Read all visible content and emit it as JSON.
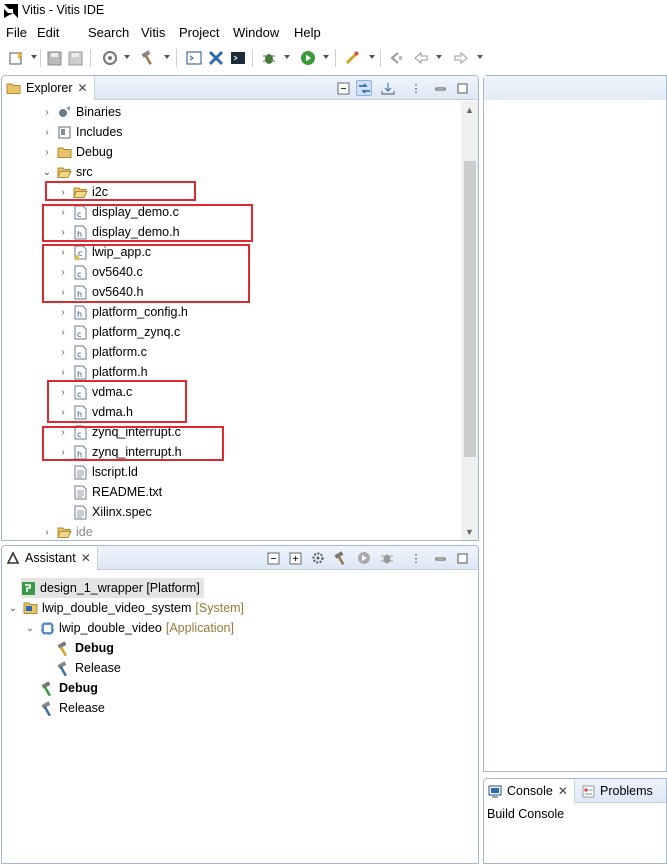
{
  "window": {
    "title": "Vitis - Vitis IDE"
  },
  "menu": [
    "File",
    "Edit",
    "Search",
    "Vitis",
    "Project",
    "Window",
    "Help"
  ],
  "explorer": {
    "tab_label": "Explorer",
    "items": [
      {
        "label": "Binaries",
        "icon": "binaries-icon"
      },
      {
        "label": "Includes",
        "icon": "includes-icon"
      },
      {
        "label": "Debug",
        "icon": "folder-icon"
      },
      {
        "label": "src",
        "icon": "folder-open-icon"
      },
      {
        "label": "i2c",
        "icon": "folder-icon"
      },
      {
        "label": "display_demo.c",
        "icon": "c-file-icon"
      },
      {
        "label": "display_demo.h",
        "icon": "h-file-icon"
      },
      {
        "label": "lwip_app.c",
        "icon": "c-file-warning-icon"
      },
      {
        "label": "ov5640.c",
        "icon": "c-file-icon"
      },
      {
        "label": "ov5640.h",
        "icon": "h-file-icon"
      },
      {
        "label": "platform_config.h",
        "icon": "h-file-icon"
      },
      {
        "label": "platform_zynq.c",
        "icon": "c-file-icon"
      },
      {
        "label": "platform.c",
        "icon": "c-file-icon"
      },
      {
        "label": "platform.h",
        "icon": "h-file-icon"
      },
      {
        "label": "vdma.c",
        "icon": "c-file-icon"
      },
      {
        "label": "vdma.h",
        "icon": "h-file-icon"
      },
      {
        "label": "zynq_interrupt.c",
        "icon": "c-file-icon"
      },
      {
        "label": "zynq_interrupt.h",
        "icon": "h-file-icon"
      },
      {
        "label": "lscript.ld",
        "icon": "text-file-icon"
      },
      {
        "label": "README.txt",
        "icon": "text-file-icon"
      },
      {
        "label": "Xilinx.spec",
        "icon": "text-file-icon"
      },
      {
        "label": "ide",
        "icon": "folder-icon"
      }
    ]
  },
  "assistant": {
    "tab_label": "Assistant",
    "platform": "design_1_wrapper [Platform]",
    "system": "lwip_double_video_system",
    "system_tag": "[System]",
    "application": "lwip_double_video",
    "application_tag": "[Application]",
    "app_debug": "Debug",
    "app_release": "Release",
    "sys_debug": "Debug",
    "sys_release": "Release"
  },
  "console": {
    "tab_label": "Console",
    "tab2_label": "Problems",
    "subtitle": "Build Console"
  },
  "colors": {
    "highlight_box": "#e0282e",
    "tag": "#9a7a3a"
  }
}
